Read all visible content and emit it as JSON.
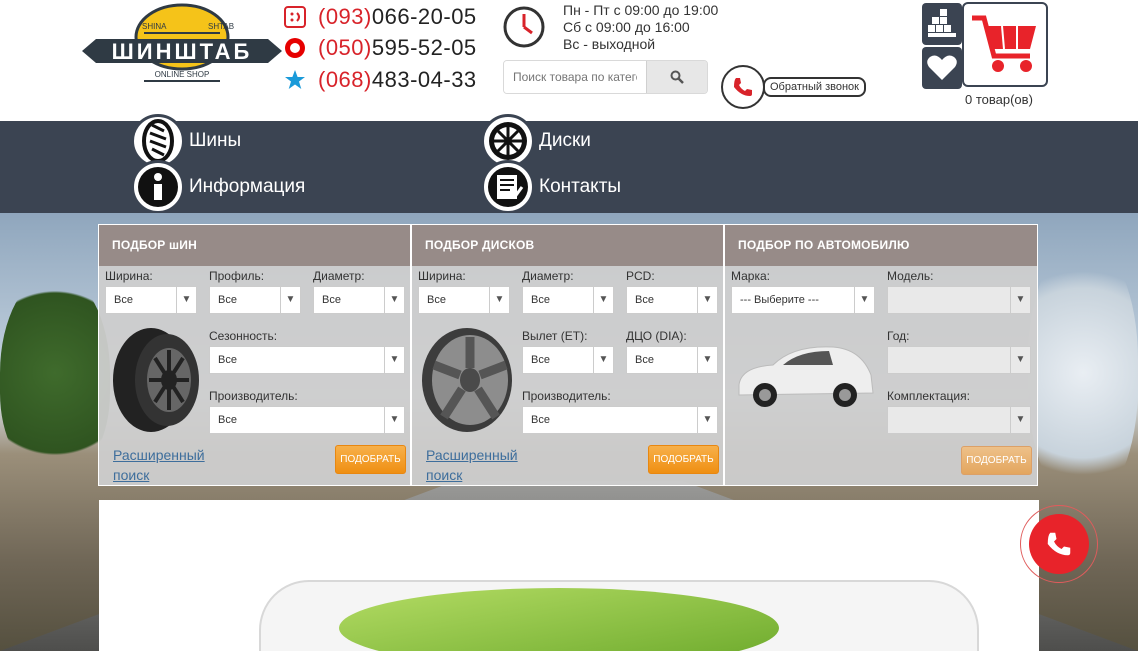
{
  "header": {
    "logo_text": "ШИНШТАБ",
    "logo_sub": "ONLINE SHOP",
    "logo_left": "SHINA",
    "logo_right": "SHTAB",
    "phones": [
      {
        "code": "(093)",
        "number": "066-20-05",
        "icon": "smile-icon"
      },
      {
        "code": "(050)",
        "number": "595-52-05",
        "icon": "vodafone-icon"
      },
      {
        "code": "(068)",
        "number": "483-04-33",
        "icon": "star-icon"
      }
    ],
    "hours": [
      "Пн - Пт с 09:00 до 19:00",
      "Сб с 09:00 до 16:00",
      "Вс - выходной"
    ],
    "search_placeholder": "Поиск товара по категории",
    "callback_label": "Обратный звонок",
    "cart_count": "0 товар(ов)",
    "accent_color": "#d8232a"
  },
  "nav": [
    {
      "label": "Шины",
      "icon": "tire-icon"
    },
    {
      "label": "Диски",
      "icon": "rim-icon"
    },
    {
      "label": "Информация",
      "icon": "info-icon"
    },
    {
      "label": "Контакты",
      "icon": "contacts-icon"
    }
  ],
  "panels": {
    "tires": {
      "title": "ПОДБОР шИН",
      "width_label": "Ширина:",
      "width_value": "Все",
      "profile_label": "Профиль:",
      "profile_value": "Все",
      "diameter_label": "Диаметр:",
      "diameter_value": "Все",
      "season_label": "Сезонность:",
      "season_value": "Все",
      "maker_label": "Производитель:",
      "maker_value": "Все",
      "advanced_1": "Расширенный",
      "advanced_2": "поиск",
      "button": "ПОДОБРАТЬ"
    },
    "rims": {
      "title": "ПОДБОР ДИСКОВ",
      "width_label": "Ширина:",
      "width_value": "Все",
      "diameter_label": "Диаметр:",
      "diameter_value": "Все",
      "pcd_label": "PCD:",
      "pcd_value": "Все",
      "et_label": "Вылет (ET):",
      "et_value": "Все",
      "dia_label": "ДЦО (DIA):",
      "dia_value": "Все",
      "maker_label": "Производитель:",
      "maker_value": "Все",
      "advanced_1": "Расширенный",
      "advanced_2": "поиск",
      "button": "ПОДОБРАТЬ"
    },
    "auto": {
      "title": "ПОДБОР ПО АВТОМОБИЛЮ",
      "brand_label": "Марка:",
      "brand_value": "--- Выберите ---",
      "model_label": "Модель:",
      "year_label": "Год:",
      "trim_label": "Комплектация:",
      "button": "ПОДОБРАТЬ"
    }
  }
}
